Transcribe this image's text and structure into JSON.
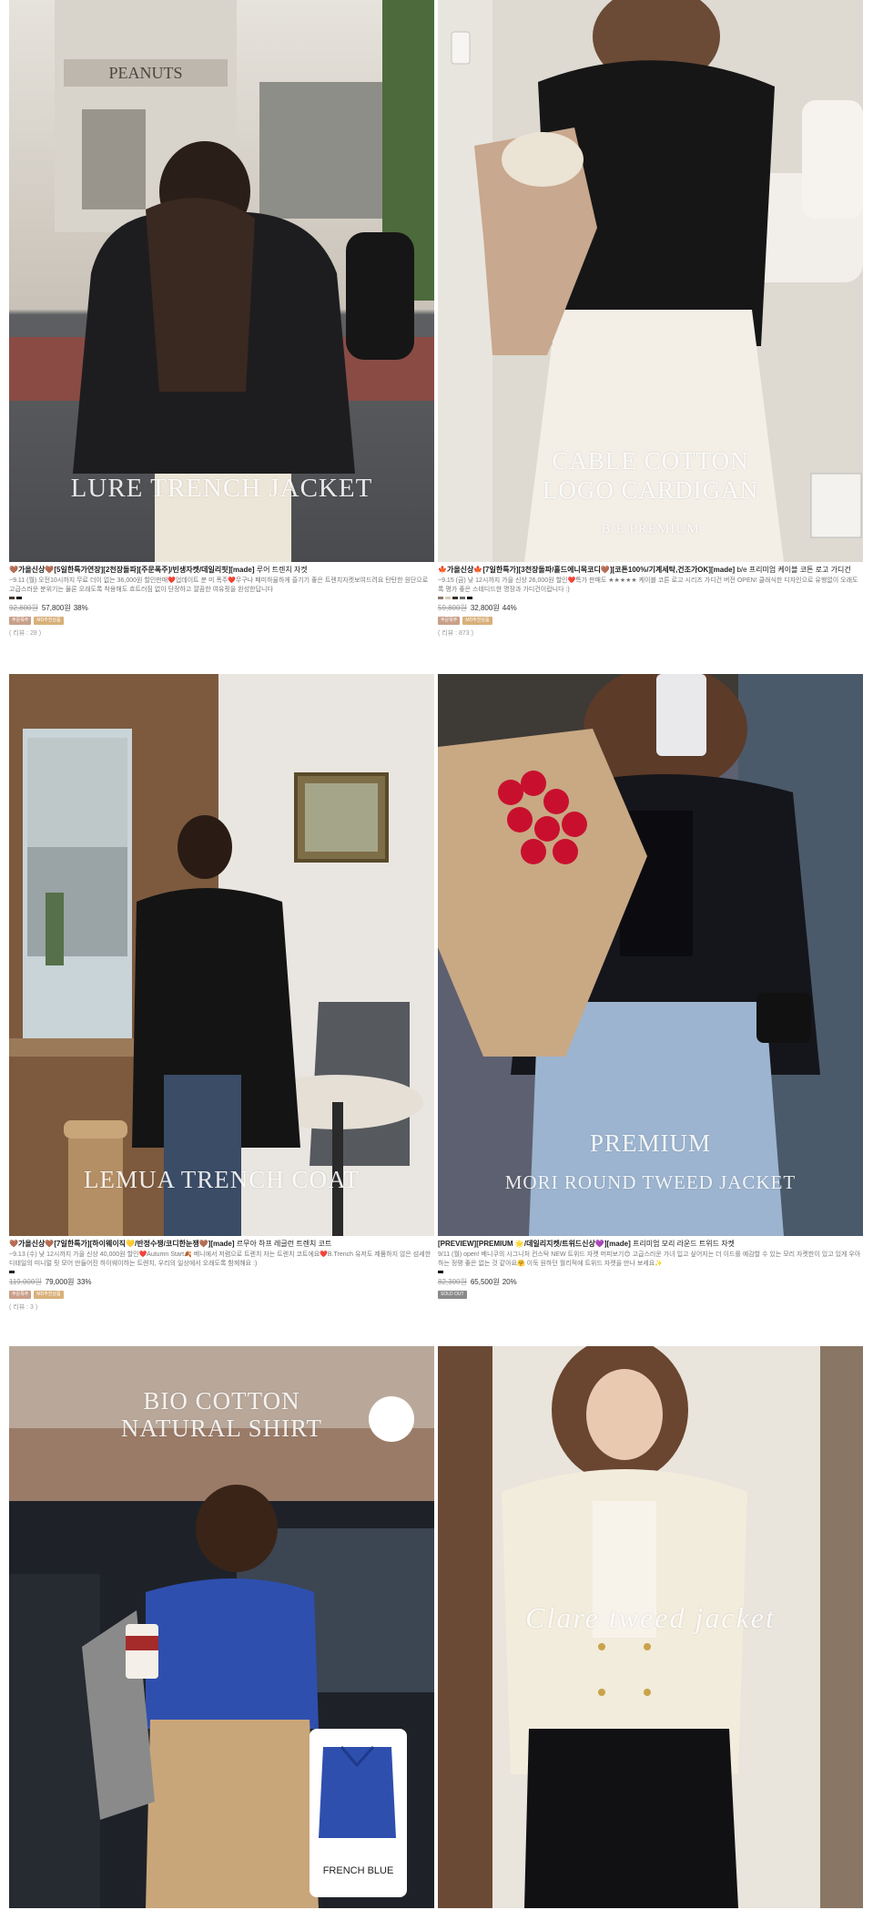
{
  "products": [
    {
      "overlay_title": "LURE TRENCH JACKET",
      "overlay_sub": "",
      "name_prefix": "🤎가을신상🤎[5일한특가연장][2천장돌파][주문폭주]/빈생자켓/데일리핏][made]",
      "name_suffix": "루어 트렌치 자켓",
      "desc": "~9.11 (월) 오전10시까지 무료 더이 없는 36,000원 할인판매❤️업데이트 분 미 폭주❤️무구나 페미하율하게 즐기기 좋은 트렌치자켓보여드려요 탄탄한 원단으로 고급스러운 분위기는 물론 오래도록 착용해도 흐트러짐 없이 단정하고 깔끔한 여유핏을 완성한답니다",
      "swatches": [
        "#4a3a2c",
        "#111111"
      ],
      "orig_price": "92,800원",
      "sale_price": "57,800원",
      "discount": "38%",
      "badges": [
        {
          "label": "주문폭주",
          "color": "#c9a08a"
        },
        {
          "label": "MD추천상품",
          "color": "#d8b07a"
        }
      ],
      "review": "( 리뷰 : 28 )",
      "colors": {
        "bg": "#5b5e63",
        "accent": "#b7a99a"
      }
    },
    {
      "overlay_title": "CABLE COTTON\nLOGO CARDIGAN",
      "overlay_sub": "B/E PREMIUM",
      "name_prefix": "🍁가을신상🍁[7일한특가][3천장돌파/홀드에니목코디🤎][코튼100%/기계세탁,건조가OK][made]",
      "name_suffix": "b/e 프리미엄 케이블 코튼 로고 가디건",
      "desc": "~9.15 (금) 낮 12시까지 가을 신상 26,000원 할인❤️특가 판매도 ★★★★★ 케이블 코튼 로고 시리즈 가디건 버전 OPEN! 클래식한 디자인으로 유행없이 오래도록 평가 좋은 스테디드한 명장과 가디건이랍니다 :)",
      "swatches": [
        "#8a7a6a",
        "#d8ccb8",
        "#3a2f2a",
        "#6b6b6b",
        "#111111"
      ],
      "orig_price": "59,800원",
      "sale_price": "32,800원",
      "discount": "44%",
      "badges": [
        {
          "label": "주문폭주",
          "color": "#c9a08a"
        },
        {
          "label": "MD추천상품",
          "color": "#d8b07a"
        }
      ],
      "review": "( 리뷰 : 873 )",
      "colors": {
        "bg": "#d9d3cb",
        "accent": "#f2efe9"
      }
    },
    {
      "overlay_title": "LEMUA TRENCH COAT",
      "overlay_sub": "",
      "name_prefix": "🤎가을신상🤎[7일한특가][하이웨이직💛/반정수쟁/코디한눈쟁🤎][made]",
      "name_suffix": "르무아 하프 레글런 트렌치 코트",
      "desc": "~9.13 (수) 낮 12시까지 가을 신상 40,000원 할인❤️Autumn Start🍂 베니에서 저렴으로 트렌치 자는 트렌치 코트에요❤️B.Trench 유저도 제품하지 않은 섬세한 디테일의 미니멀 핏 모어 만들어진 하이웨이하는 트렌치, 우리의 일상에서 오래도록 함께해요 :)",
      "swatches": [
        "#222222"
      ],
      "orig_price": "119,000원",
      "sale_price": "79,000원",
      "discount": "33%",
      "badges": [
        {
          "label": "주문폭주",
          "color": "#c9a08a"
        },
        {
          "label": "MD추천상품",
          "color": "#d8b07a"
        }
      ],
      "review": "( 리뷰 : 3 )",
      "colors": {
        "bg": "#8c7b68",
        "accent": "#e8e4de"
      }
    },
    {
      "overlay_title": "PREMIUM",
      "overlay_sub": "MORI ROUND TWEED JACKET",
      "name_prefix": "[PREVIEW][PREMIUM 🌟/데일리지켓/트위드신상💜][made]",
      "name_suffix": "프리미엄 모리 라운드 트위드 자켓",
      "desc": "9/11 (월) open! 베니쿠의 시그니처 컨스탁 NEW 트위드 자켓 머피보기😊 고급스러운 가녀 입고 싶어지는 더 이드를 예감할 수 있는 모리 자켓한이 있고 있게 우아하는 정평 좋은 없는 것 같아요🤗 이둑 원하던 월리적에 트위드 자켓을 만나 보세요✨",
      "swatches": [
        "#111111"
      ],
      "orig_price": "82,300원",
      "sale_price": "65,500원",
      "discount": "20%",
      "badges": [
        {
          "label": "SOLD OUT",
          "color": "#8a8a8a"
        }
      ],
      "review": "",
      "colors": {
        "bg": "#6b7d95",
        "accent": "#1b1c22"
      }
    },
    {
      "overlay_title": "BIO COTTON\nNATURAL SHIRT",
      "overlay_sub": "",
      "inset_label": "FRENCH BLUE",
      "colors": {
        "bg": "#3d4a57",
        "accent": "#2f4fae"
      }
    },
    {
      "overlay_title": "Clare tweed jacket",
      "overlay_sub": "",
      "colors": {
        "bg": "#7a6a5c",
        "accent": "#f1ece2"
      }
    }
  ]
}
